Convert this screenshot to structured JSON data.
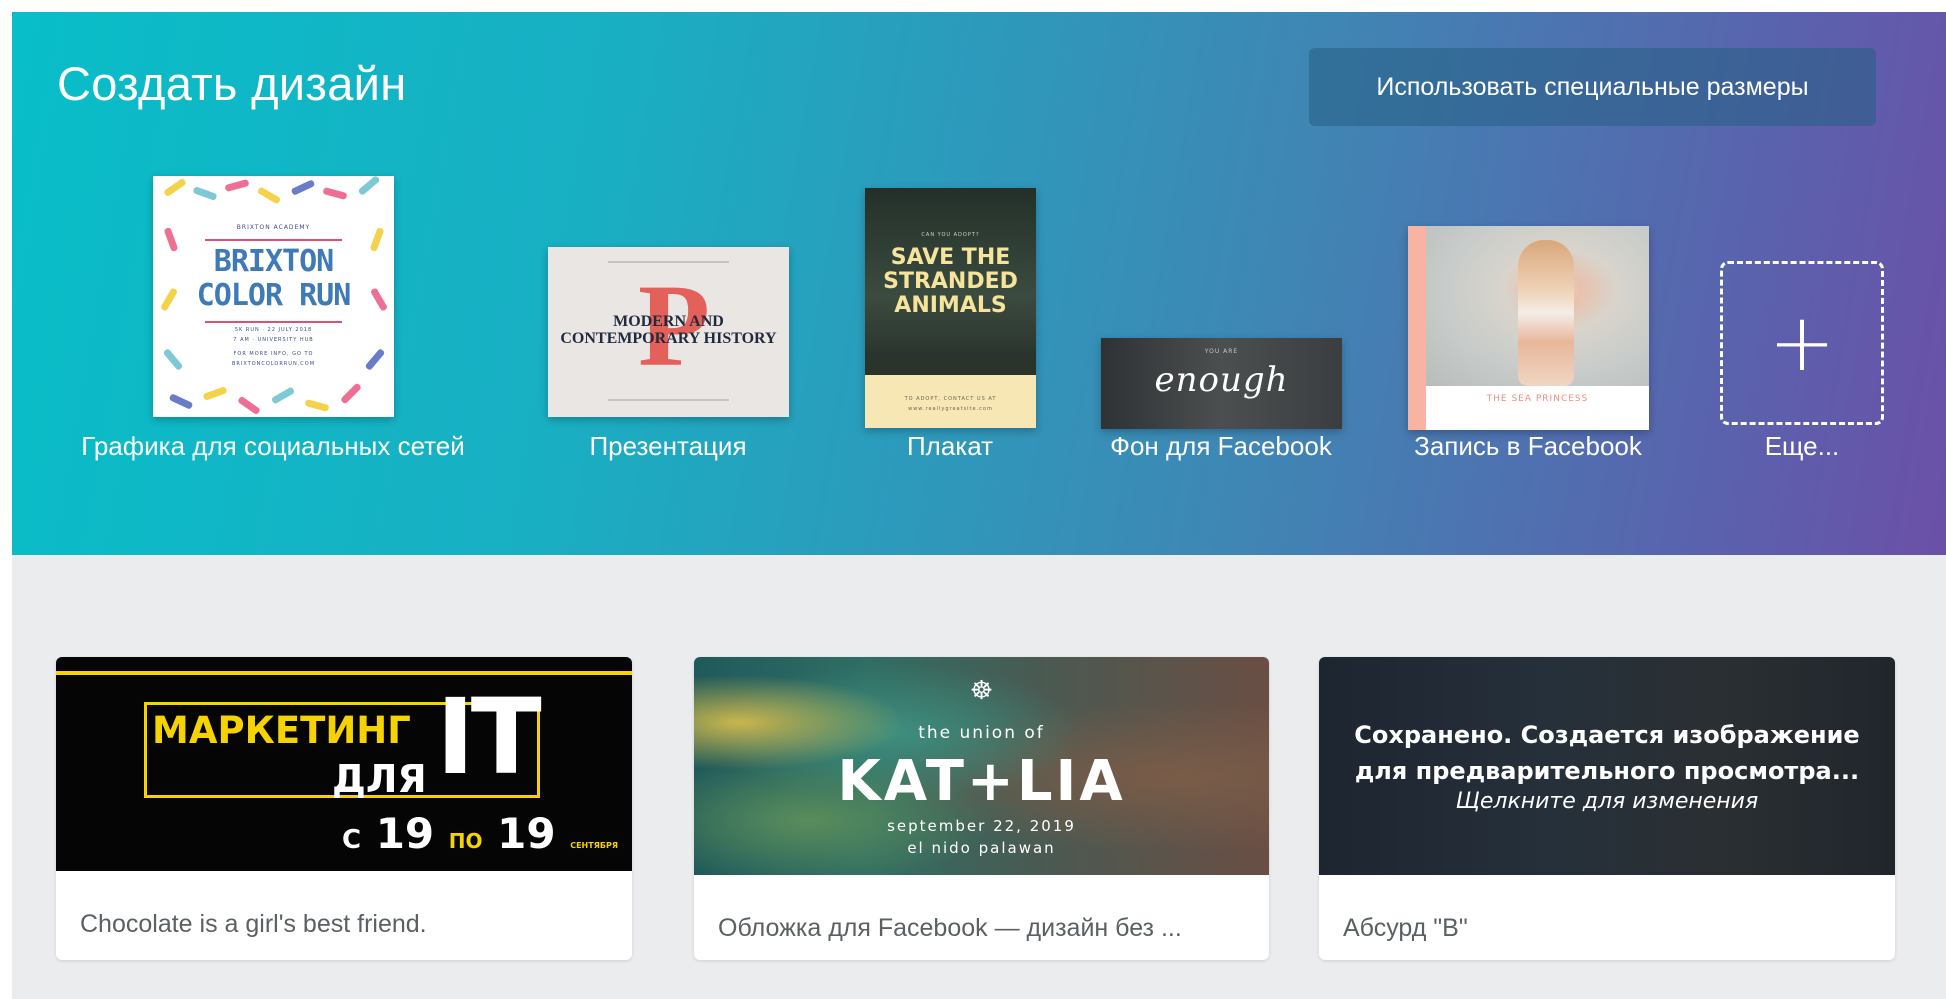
{
  "header": {
    "title": "Создать дизайн",
    "custom_size_button": "Использовать специальные размеры"
  },
  "design_types": [
    {
      "label": "Графика для социальных сетей"
    },
    {
      "label": "Презентация"
    },
    {
      "label": "Плакат"
    },
    {
      "label": "Фон для Facebook"
    },
    {
      "label": "Запись в Facebook"
    },
    {
      "label": "Еще..."
    }
  ],
  "thumbnails": {
    "social": {
      "school": "BRIXTON ACADEMY",
      "title": "BRIXTON COLOR RUN",
      "line1": "5K RUN · 22 JULY 2018",
      "line2": "7 AM · UNIVERSITY HUB",
      "line3": "FOR MORE INFO, GO TO",
      "line4": "BRIXTONCOLORRUN.COM"
    },
    "presentation": {
      "letter": "P",
      "title": "MODERN AND CONTEMPORARY HISTORY"
    },
    "poster": {
      "kicker": "CAN YOU ADOPT?",
      "title": "SAVE THE STRANDED ANIMALS",
      "footer": "TO ADOPT, CONTACT US AT",
      "footer2": "www.reallygreatsite.com"
    },
    "fb_cover": {
      "kicker": "YOU ARE",
      "word": "enough"
    },
    "fb_post": {
      "caption": "THE SEA PRINCESS"
    }
  },
  "recent_designs": [
    {
      "caption": "Chocolate is a girl's best friend.",
      "image": {
        "word1": "МАРКЕТИНГ",
        "word2": "ДЛЯ",
        "word3": "IT",
        "c": "С",
        "from_day": "19",
        "po": "ПО",
        "to_day": "19",
        "month1": "СЕНТЯБРЯ",
        "month2": "СЕНТЯБРЯ"
      }
    },
    {
      "caption": "Обложка для Facebook — дизайн без ...",
      "image": {
        "icon": "helm-icon",
        "kicker": "the union of",
        "names": "KAT+LIA",
        "date": "september 22, 2019",
        "place": "el nido palawan"
      }
    },
    {
      "caption": "Абсурд \"В\"",
      "image": {
        "status1": "Сохранено. Создается изображение",
        "status2": "для предварительного просмотра...",
        "hint": "Щелкните для изменения"
      }
    }
  ],
  "colors": {
    "hero_start": "#08bec8",
    "hero_end": "#6b50a8",
    "background": "#ebecee",
    "accent_yellow": "#f5d300"
  }
}
